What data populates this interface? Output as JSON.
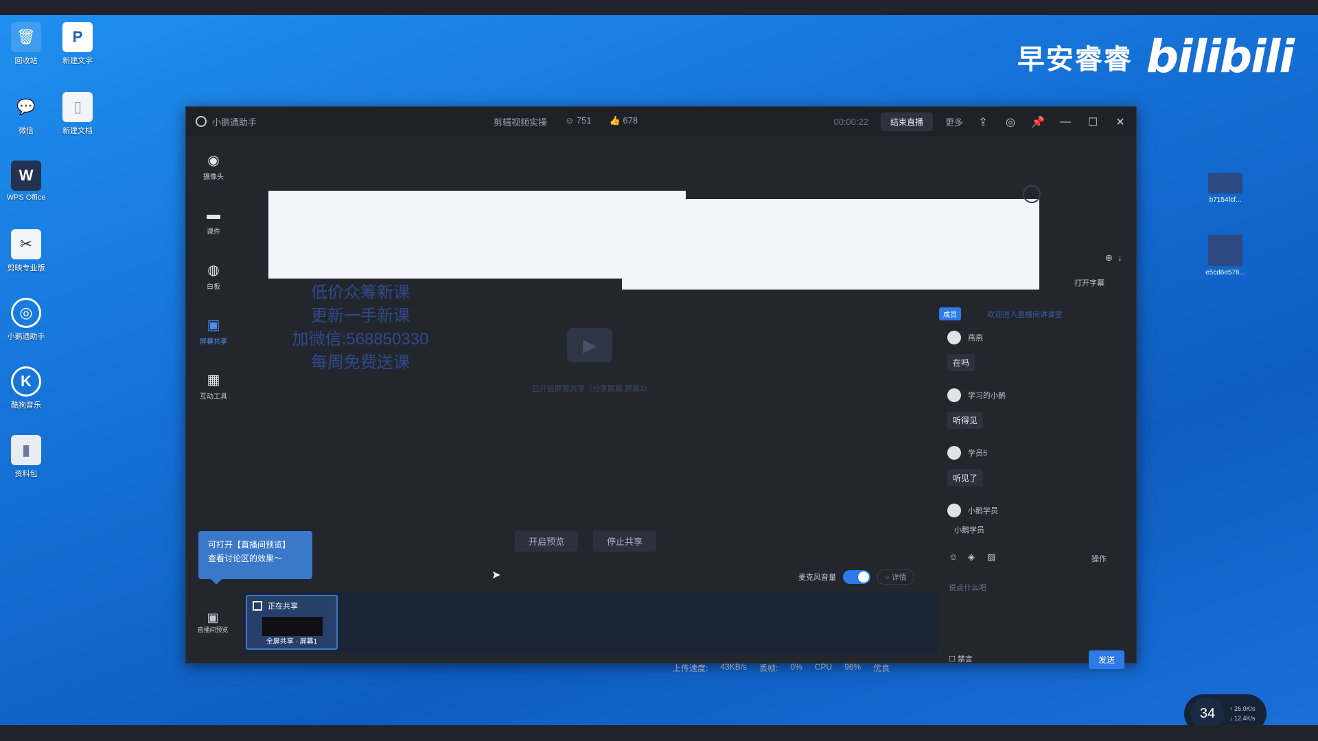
{
  "desktop": {
    "icons_left": [
      {
        "name": "recycle-bin",
        "label": "回收站",
        "glyph": "🗑"
      },
      {
        "name": "wps-doc",
        "label": "新建文字",
        "glyph": "P"
      },
      {
        "name": "wechat",
        "label": "微信",
        "glyph": "💬"
      },
      {
        "name": "text-file",
        "label": "新建文档",
        "glyph": "▯"
      },
      {
        "name": "wps-office",
        "label": "WPS Office",
        "glyph": "W"
      },
      {
        "name": "app-5",
        "label": "剪映专业版",
        "glyph": "✂"
      },
      {
        "name": "app-6",
        "label": "小鹅通助手",
        "glyph": "◎"
      },
      {
        "name": "app-7",
        "label": "酷狗音乐",
        "glyph": "K"
      },
      {
        "name": "app-8",
        "label": "资料包",
        "glyph": "▮"
      }
    ],
    "icons_right": [
      {
        "label": "b7154fcf..."
      },
      {
        "label": "e5cd6e578..."
      }
    ],
    "watermark_cn": "早安睿睿",
    "watermark_brand": "bilibili"
  },
  "window": {
    "app_title": "小鹅通助手",
    "course_title": "剪辑视频实操",
    "viewers": "751",
    "likes": "678",
    "timer": "00:00:22",
    "end_button": "结束直播",
    "more_label": "更多"
  },
  "sidebar": {
    "items": [
      {
        "label": "摄像头"
      },
      {
        "label": "课件"
      },
      {
        "label": "白板"
      },
      {
        "label": "屏幕共享"
      },
      {
        "label": "互动工具"
      }
    ],
    "bottom_tool": "直播间预览"
  },
  "stage": {
    "overlay_lines": [
      "低价众筹新课",
      "更新一手新课",
      "加微信:568850330",
      "每周免费送课"
    ],
    "placeholder_text": "已开启屏幕共享（分享屏幕 屏幕1）",
    "preview_button": "开启预览",
    "stop_share_button": "停止共享",
    "hint_line1": "可打开【直播间预览】",
    "hint_line2": "查看讨论区的效果～",
    "mic_audio_label": "麦克风音量",
    "detail_button": "○ 详情",
    "share_card_title": "正在共享",
    "share_card_caption": "全屏共享 · 屏幕1"
  },
  "status_bar": {
    "upload_label": "上传速度:",
    "upload_value": "43KB/s",
    "drop_label": "丢帧:",
    "drop_value": "0%",
    "cpu_label": "CPU",
    "cpu_value": "96%",
    "quality": "优良"
  },
  "chat": {
    "subtitle_label": "打开字幕",
    "pinned": "成员",
    "pinned_line": "欢迎进入直播间讲课室",
    "messages": [
      {
        "name": "燕燕",
        "text": "在吗"
      },
      {
        "name": "学习的小鹅",
        "text": "听得见"
      },
      {
        "name": "学员5",
        "text": "听见了"
      },
      {
        "name": "小鹅学员",
        "text": "小鹅学员"
      }
    ],
    "ops_label": "操作",
    "input_placeholder": "说点什么吧",
    "anon_label": "禁言",
    "send_button": "发送"
  },
  "network": {
    "percent": "34",
    "up": "↑ 26.0K/s",
    "down": "↓ 12.4K/s"
  }
}
